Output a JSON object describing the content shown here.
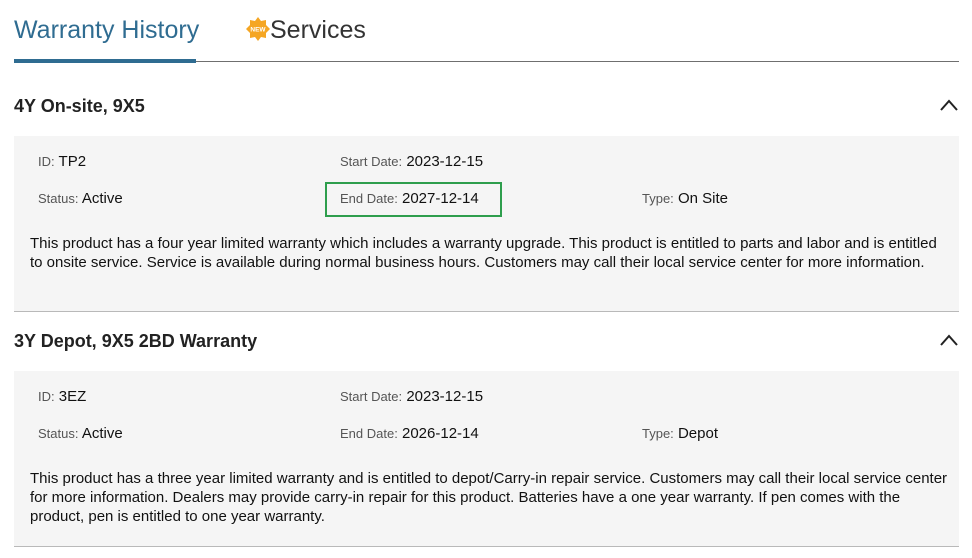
{
  "tabs": [
    {
      "label": "Warranty History",
      "active": true
    },
    {
      "label": "Services",
      "badge": "NEW"
    }
  ],
  "warranties": [
    {
      "title": "4Y On-site, 9X5",
      "id_label": "ID:",
      "id_value": "TP2",
      "start_label": "Start Date:",
      "start_value": "2023-12-15",
      "status_label": "Status:",
      "status_value": "Active",
      "end_label": "End Date:",
      "end_value": "2027-12-14",
      "type_label": "Type:",
      "type_value": "On Site",
      "description": "This product has a four year limited warranty which includes a warranty upgrade. This product is entitled to parts and labor and is entitled to onsite service. Service is available during normal business hours. Customers may call their local service center for more information."
    },
    {
      "title": "3Y Depot, 9X5 2BD Warranty",
      "id_label": "ID:",
      "id_value": "3EZ",
      "start_label": "Start Date:",
      "start_value": "2023-12-15",
      "status_label": "Status:",
      "status_value": "Active",
      "end_label": "End Date:",
      "end_value": "2026-12-14",
      "type_label": "Type:",
      "type_value": "Depot",
      "description": "This product has a three year limited warranty and is entitled to depot/Carry-in repair service. Customers may call their local service center for more information. Dealers may provide carry-in repair for this product. Batteries have a one year warranty. If pen comes with the product, pen is entitled to one year warranty."
    }
  ],
  "colors": {
    "accent": "#2f6c91",
    "highlight": "#2e9e4d",
    "badge": "#f5a623"
  },
  "icons": {
    "collapse": "chevron-up-icon",
    "badge": "new-badge-icon"
  }
}
